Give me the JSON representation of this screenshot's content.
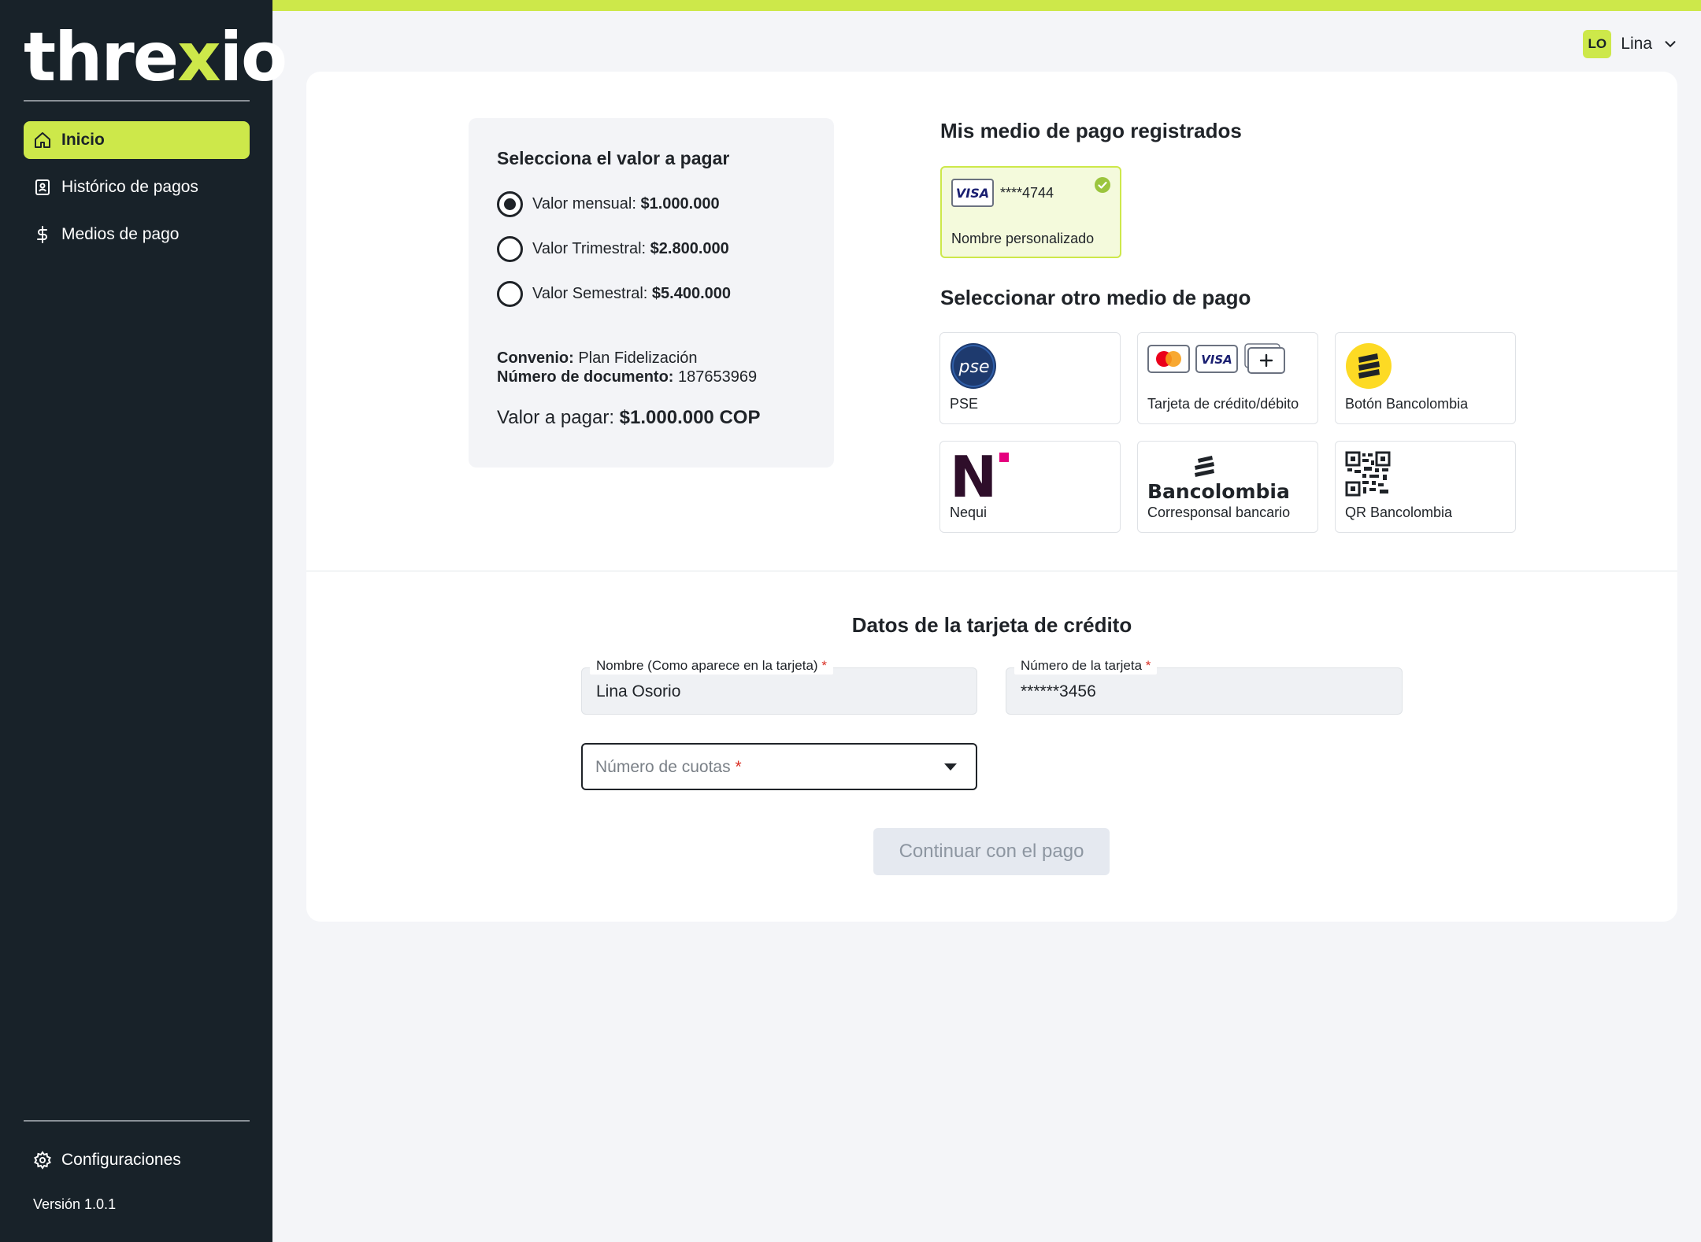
{
  "brand": {
    "logo_pre": "thre",
    "logo_x": "x",
    "logo_post": "io",
    "accent_color": "#cde84a",
    "sidebar_color": "#182229"
  },
  "sidebar": {
    "items": [
      {
        "label": "Inicio",
        "icon": "home-icon",
        "active": true
      },
      {
        "label": "Histórico de pagos",
        "icon": "receipt-icon"
      },
      {
        "label": "Medios de pago",
        "icon": "dollar-icon"
      }
    ],
    "settings_label": "Configuraciones",
    "version": "Versión 1.0.1"
  },
  "user": {
    "initials": "LO",
    "name": "Lina"
  },
  "amount": {
    "title": "Selecciona el valor a pagar",
    "options": [
      {
        "label": "Valor mensual:",
        "value": "$1.000.000",
        "selected": true
      },
      {
        "label": "Valor Trimestral:",
        "value": "$2.800.000",
        "selected": false
      },
      {
        "label": "Valor Semestral:",
        "value": "$5.400.000",
        "selected": false
      }
    ],
    "convenio_label": "Convenio:",
    "convenio_value": "Plan Fidelización",
    "document_label": "Número de documento:",
    "document_value": "187653969",
    "total_label": "Valor a pagar:",
    "total_value": "$1.000.000 COP"
  },
  "saved_methods": {
    "title": "Mis medio de pago registrados",
    "card": {
      "brand": "VISA",
      "masked": "****4744",
      "name": "Nombre personalizado",
      "selected": true
    }
  },
  "other_methods": {
    "title": "Seleccionar otro medio de pago",
    "items": [
      {
        "label": "PSE",
        "icon": "pse-logo-icon",
        "icon_text": "pse"
      },
      {
        "label": "Tarjeta de crédito/débito",
        "icon": "cards-icon",
        "icon_text": "VISA"
      },
      {
        "label": "Botón Bancolombia",
        "icon": "bancolombia-logo-icon"
      },
      {
        "label": "Nequi",
        "icon": "nequi-logo-icon",
        "icon_text": "N"
      },
      {
        "label": "Corresponsal bancario",
        "icon": "bancolombia-wordmark-icon",
        "icon_text": "Bancolombia"
      },
      {
        "label": "QR Bancolombia",
        "icon": "qr-code-icon"
      }
    ]
  },
  "form": {
    "title": "Datos de la tarjeta de crédito",
    "name_label": "Nombre (Como aparece en la tarjeta)",
    "name_value": "Lina Osorio",
    "number_label": "Número de la tarjeta",
    "number_value": "******3456",
    "required_mark": "*",
    "installments_placeholder": "Número de cuotas",
    "submit_label": "Continuar con el pago"
  }
}
